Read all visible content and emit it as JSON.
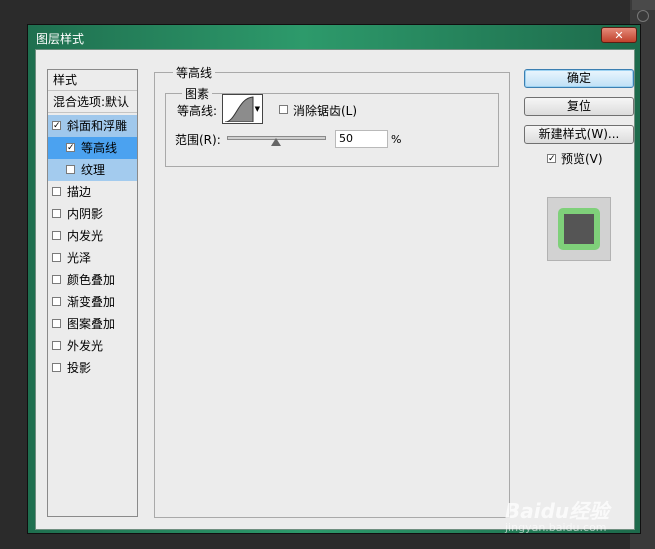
{
  "window": {
    "title": "图层样式",
    "close_glyph": "✕"
  },
  "styles_list": {
    "header": "样式",
    "blend_options": "混合选项:默认",
    "items": [
      {
        "label": "斜面和浮雕",
        "checked": true
      },
      {
        "label": "等高线",
        "checked": true
      },
      {
        "label": "纹理",
        "checked": false
      },
      {
        "label": "描边",
        "checked": false
      },
      {
        "label": "内阴影",
        "checked": false
      },
      {
        "label": "内发光",
        "checked": false
      },
      {
        "label": "光泽",
        "checked": false
      },
      {
        "label": "颜色叠加",
        "checked": false
      },
      {
        "label": "渐变叠加",
        "checked": false
      },
      {
        "label": "图案叠加",
        "checked": false
      },
      {
        "label": "外发光",
        "checked": false
      },
      {
        "label": "投影",
        "checked": false
      }
    ]
  },
  "panel": {
    "section_title": "等高线",
    "group_title": "图素",
    "contour_label": "等高线:",
    "anti_alias_label": "消除锯齿(L)",
    "anti_alias_checked": false,
    "range_label": "范围(R):",
    "range_value": "50",
    "range_unit": "%"
  },
  "buttons": {
    "ok": "确定",
    "reset": "复位",
    "new_style": "新建样式(W)...",
    "preview_label": "预览(V)",
    "preview_checked": true
  },
  "watermark": {
    "brand": "Baidu经验",
    "url": "jingyan.baidu.com"
  },
  "colors": {
    "title_bar": "#2d9a6b",
    "selected_item": "#4ba2f0",
    "preview_glow": "#7fd07a"
  }
}
